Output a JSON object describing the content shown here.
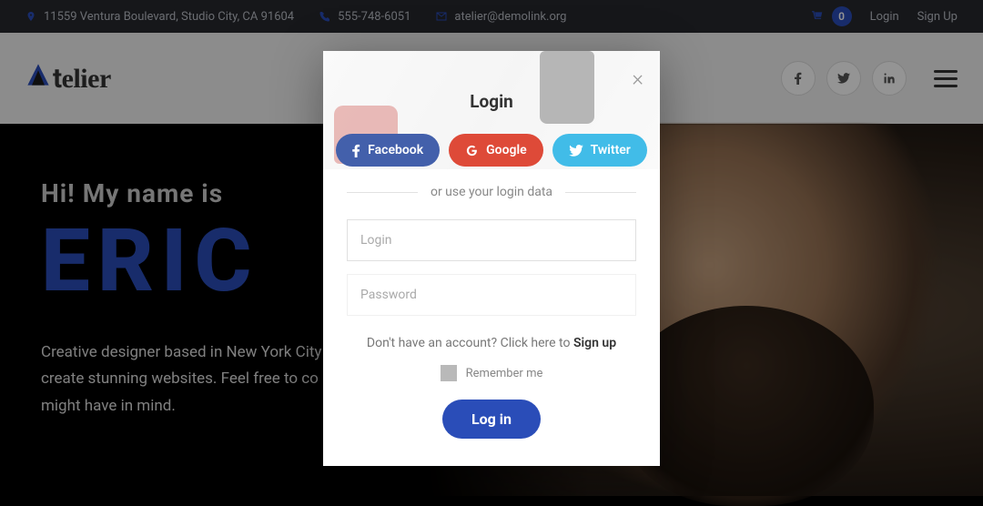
{
  "topbar": {
    "address": "11559 Ventura Boulevard, Studio City, CA 91604",
    "phone": "555-748-6051",
    "email": "atelier@demolink.org",
    "cart_count": "0",
    "login": "Login",
    "signup": "Sign Up"
  },
  "brand": {
    "name": "Atelier"
  },
  "hero": {
    "intro": "Hi! My name is",
    "name": "ERIC",
    "desc_l1": "Creative designer based in New York City",
    "desc_l2": "create stunning websites. Feel free to co",
    "desc_l3": "might have in mind."
  },
  "modal": {
    "title": "Login",
    "facebook": "Facebook",
    "google": "Google",
    "twitter": "Twitter",
    "or_text": "or use your login data",
    "login_ph": "Login",
    "password_ph": "Password",
    "signup_prompt": "Don't have an account? Click here to ",
    "signup_link": "Sign up",
    "remember": "Remember me",
    "submit": "Log in"
  }
}
